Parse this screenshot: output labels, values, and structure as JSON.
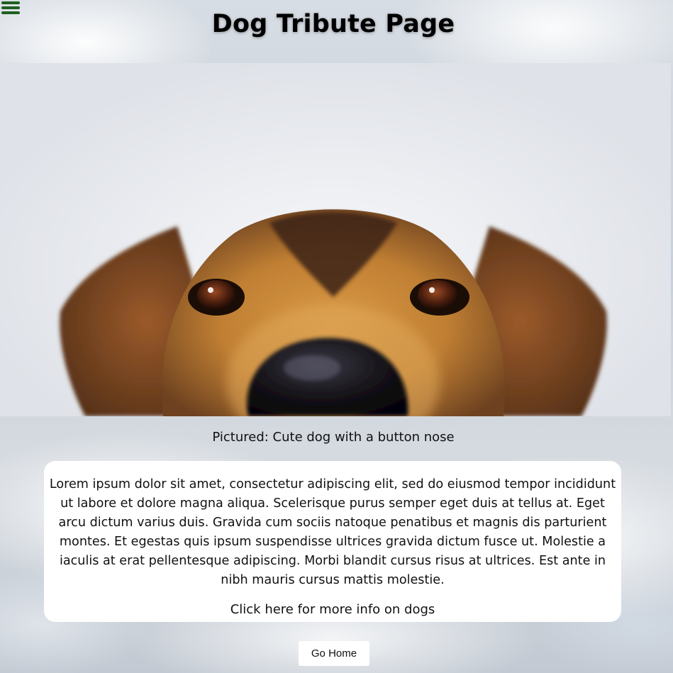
{
  "header": {
    "menu_icon": "hamburger-menu-icon",
    "title": "Dog Tribute Page"
  },
  "hero": {
    "subject": "dog-face"
  },
  "caption": "Pictured: Cute dog with a button nose",
  "info": {
    "body": "Lorem ipsum dolor sit amet, consectetur adipiscing elit, sed do eiusmod tempor incididunt ut labore et dolore magna aliqua. Scelerisque purus semper eget duis at tellus at. Eget arcu dictum varius duis. Gravida cum sociis natoque penatibus et magnis dis parturient montes. Et egestas quis ipsum suspendisse ultrices gravida dictum fusce ut. Molestie a iaculis at erat pellentesque adipiscing. Morbi blandit cursus risus at ultrices. Est ante in nibh mauris cursus mattis molestie.",
    "link_label": "Click here for more info on dogs"
  },
  "footer": {
    "home_button_label": "Go Home"
  },
  "colors": {
    "menu_icon": "#1f5f1f",
    "card_background": "#ffffff",
    "dog_fur": "#c8893a",
    "dog_dark": "#2a1a10"
  }
}
